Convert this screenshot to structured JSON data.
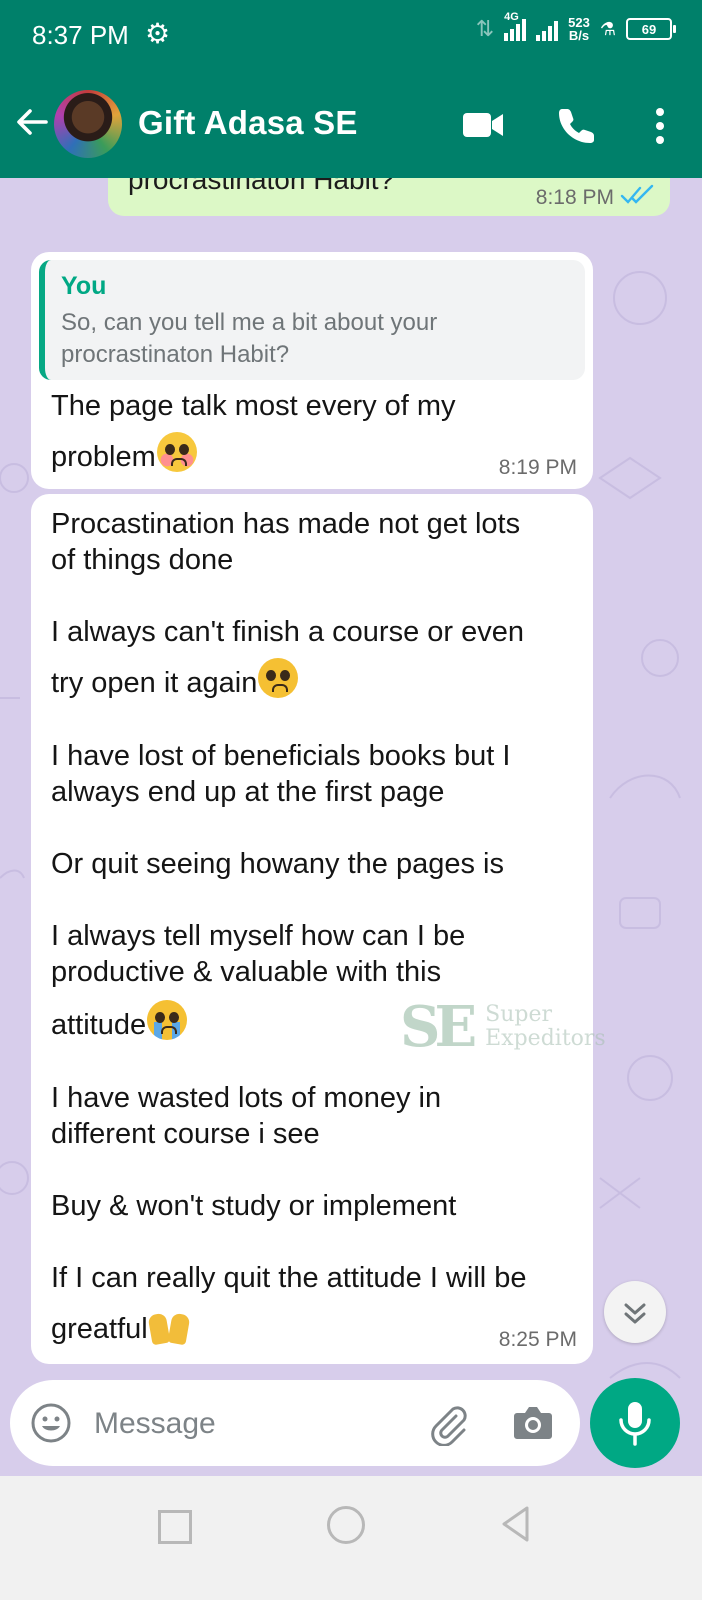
{
  "status_bar": {
    "time": "8:37 PM",
    "network_type": "4G",
    "speed_value": "523",
    "speed_unit": "B/s",
    "battery": "69"
  },
  "header": {
    "contact_name": "Gift Adasa SE"
  },
  "messages": {
    "outgoing": {
      "text": "procrastinaton Habit?",
      "time": "8:18 PM",
      "status": "read"
    },
    "reply": {
      "quoted_author": "You",
      "quoted_text": "So, can you tell me a bit about your procrastinaton Habit?",
      "line1": "The page talk most every of my",
      "line2": "problem",
      "time": "8:19 PM"
    },
    "long": {
      "p1a": "Procastination has made not get lots",
      "p1b": "of things done",
      "p2a": "I always can't finish a course or even",
      "p2b": "try open it again",
      "p3a": "I have lost of beneficials books but I",
      "p3b": "always end up at the first page",
      "p4": "Or quit seeing howany the pages is",
      "p5a": "I always tell myself how can I be",
      "p5b": "productive & valuable with this",
      "p5c": "attitude",
      "p6a": "I have wasted lots of money in",
      "p6b": "different course i see",
      "p7": "Buy & won't study or implement",
      "p8a": "If I can really quit the attitude I will be",
      "p8b": "greatful",
      "time": "8:25 PM"
    }
  },
  "watermark": {
    "logo": "SE",
    "line1": "Super",
    "line2": "Expeditors"
  },
  "composer": {
    "placeholder": "Message"
  },
  "colors": {
    "header": "#00806a",
    "accent": "#00a884",
    "chat_bg": "#d7cdeb",
    "outgoing_bubble": "#dcf8c6",
    "incoming_bubble": "#ffffff"
  }
}
